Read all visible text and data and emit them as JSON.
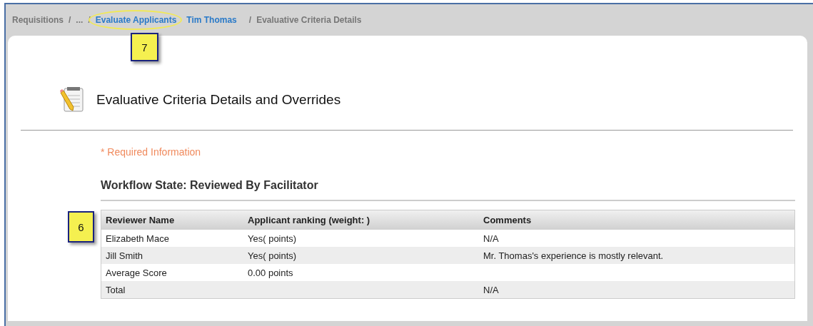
{
  "breadcrumb": [
    {
      "label": "Requisitions",
      "kind": "text"
    },
    {
      "label": "/",
      "kind": "separator"
    },
    {
      "label": "...",
      "kind": "text"
    },
    {
      "label": "/",
      "kind": "separator"
    },
    {
      "label": "Evaluate Applicants",
      "kind": "link",
      "highlighted": true
    },
    {
      "label": "Tim Thomas",
      "kind": "link",
      "highlighted": false
    },
    {
      "label": "/",
      "kind": "separator"
    },
    {
      "label": "Evaluative Criteria Details",
      "kind": "text"
    }
  ],
  "callouts": [
    "7",
    "6"
  ],
  "page_title": "Evaluative Criteria Details and Overrides",
  "required_note": "* Required Information",
  "workflow_state": "Workflow State: Reviewed By Facilitator",
  "table": {
    "columns": [
      "Reviewer Name",
      "Applicant ranking (weight: )",
      "Comments"
    ],
    "rows": [
      [
        "Elizabeth Mace",
        "Yes( points)",
        "N/A"
      ],
      [
        "Jill Smith",
        "Yes( points)",
        "Mr. Thomas's experience is mostly relevant."
      ],
      [
        "Average Score",
        "0.00 points",
        ""
      ],
      [
        "Total",
        "",
        "N/A"
      ]
    ]
  }
}
